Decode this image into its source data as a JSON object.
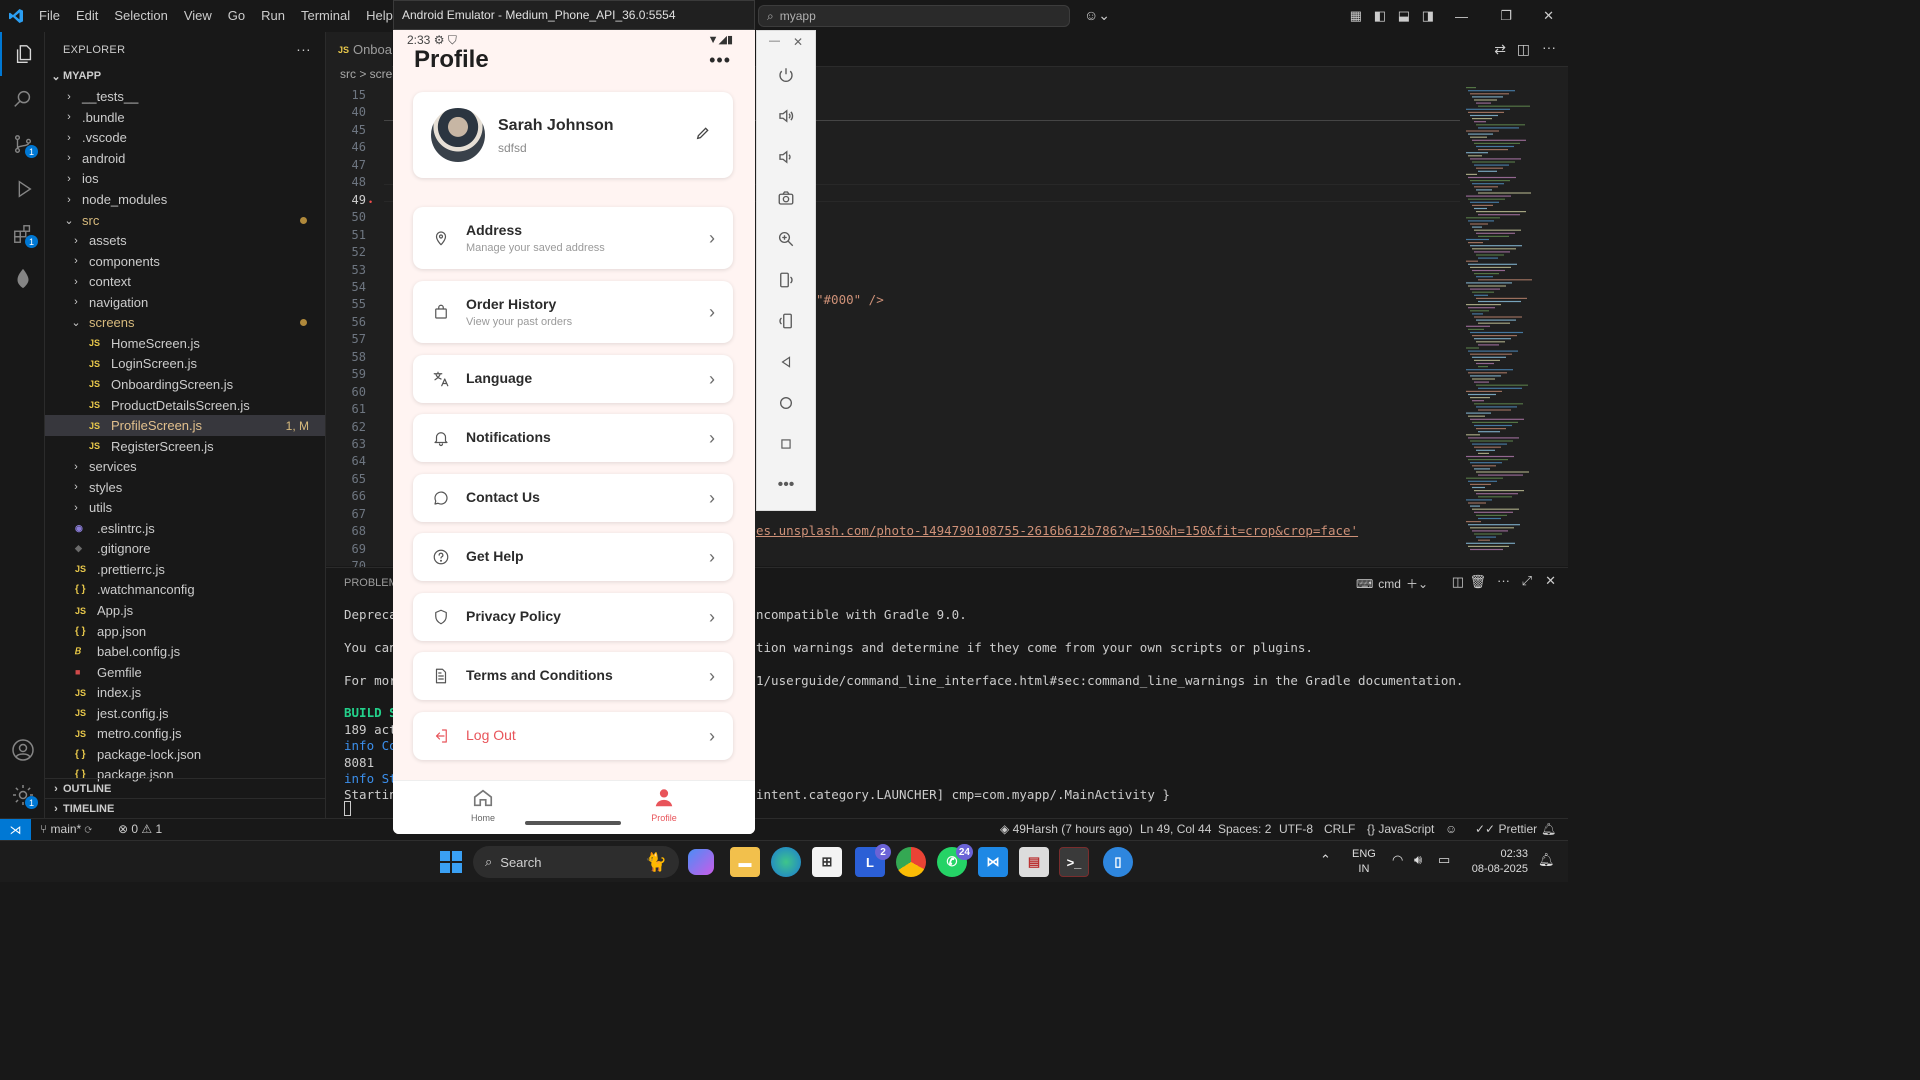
{
  "titlebar": {
    "menu": [
      "File",
      "Edit",
      "Selection",
      "View",
      "Go",
      "Run",
      "Terminal",
      "Help"
    ],
    "search": "myapp"
  },
  "explorer": {
    "title": "EXPLORER",
    "root": "MYAPP",
    "items": [
      {
        "label": "__tests__",
        "kind": "folder",
        "indent": 1
      },
      {
        "label": ".bundle",
        "kind": "folder",
        "indent": 1
      },
      {
        "label": ".vscode",
        "kind": "folder",
        "indent": 1
      },
      {
        "label": "android",
        "kind": "folder",
        "indent": 1
      },
      {
        "label": "ios",
        "kind": "folder",
        "indent": 1
      },
      {
        "label": "node_modules",
        "kind": "folder",
        "indent": 1
      },
      {
        "label": "src",
        "kind": "folder-open",
        "indent": 1
      },
      {
        "label": "assets",
        "kind": "folder",
        "indent": 2
      },
      {
        "label": "components",
        "kind": "folder",
        "indent": 2
      },
      {
        "label": "context",
        "kind": "folder",
        "indent": 2
      },
      {
        "label": "navigation",
        "kind": "folder",
        "indent": 2
      },
      {
        "label": "screens",
        "kind": "folder-open",
        "indent": 2
      },
      {
        "label": "HomeScreen.js",
        "kind": "js",
        "indent": 3
      },
      {
        "label": "LoginScreen.js",
        "kind": "js",
        "indent": 3
      },
      {
        "label": "OnboardingScreen.js",
        "kind": "js",
        "indent": 3
      },
      {
        "label": "ProductDetailsScreen.js",
        "kind": "js",
        "indent": 3
      },
      {
        "label": "ProfileScreen.js",
        "kind": "js",
        "indent": 3
      },
      {
        "label": "RegisterScreen.js",
        "kind": "js",
        "indent": 3
      },
      {
        "label": "services",
        "kind": "folder",
        "indent": 2
      },
      {
        "label": "styles",
        "kind": "folder",
        "indent": 2
      },
      {
        "label": "utils",
        "kind": "folder",
        "indent": 2
      },
      {
        "label": ".eslintrc.js",
        "kind": "eslint",
        "indent": 1
      },
      {
        "label": ".gitignore",
        "kind": "git",
        "indent": 1
      },
      {
        "label": ".prettierrc.js",
        "kind": "js",
        "indent": 1
      },
      {
        "label": ".watchmanconfig",
        "kind": "json",
        "indent": 1
      },
      {
        "label": "App.js",
        "kind": "js",
        "indent": 1
      },
      {
        "label": "app.json",
        "kind": "json",
        "indent": 1
      },
      {
        "label": "babel.config.js",
        "kind": "babel",
        "indent": 1
      },
      {
        "label": "Gemfile",
        "kind": "gem",
        "indent": 1
      },
      {
        "label": "index.js",
        "kind": "js",
        "indent": 1
      },
      {
        "label": "jest.config.js",
        "kind": "js",
        "indent": 1
      },
      {
        "label": "metro.config.js",
        "kind": "js",
        "indent": 1
      },
      {
        "label": "package-lock.json",
        "kind": "json",
        "indent": 1
      },
      {
        "label": "package.json",
        "kind": "json",
        "indent": 1
      }
    ],
    "selected_status": "1, M",
    "outline": "OUTLINE",
    "timeline": "TIMELINE"
  },
  "editor": {
    "tab": "Onboa",
    "breadcrumb": "src > scre",
    "line_numbers": [
      "15",
      "40",
      "45",
      "46",
      "47",
      "48",
      "49",
      "50",
      "51",
      "52",
      "53",
      "54",
      "55",
      "56",
      "57",
      "58",
      "59",
      "60",
      "61",
      "62",
      "63",
      "64",
      "65",
      "66",
      "67",
      "68",
      "69",
      "70"
    ],
    "code_line_55": "\"#000\" />",
    "code_line_68": "es.unsplash.com/photo-1494790108755-2616b612b786?w=150&h=150&fit=crop&crop=face'"
  },
  "panel": {
    "tab": "PROBLEMS",
    "shell": "cmd",
    "lines": [
      {
        "left": "Depreca",
        "right": "ncompatible with Gradle 9.0."
      },
      {
        "left": "You can",
        "right": "tion warnings and determine if they come from your own scripts or plugins."
      },
      {
        "left": "For mor",
        "right": "1/userguide/command_line_interface.html#sec:command_line_warnings in the Gradle documentation."
      },
      {
        "left": "BUILD S",
        "right": ""
      },
      {
        "left": "189 act",
        "right": ""
      },
      {
        "left": "info Co",
        "right": ""
      },
      {
        "left": "8081",
        "right": ""
      },
      {
        "left": "info St",
        "right": ""
      },
      {
        "left": "Startin",
        "right": "intent.category.LAUNCHER] cmp=com.myapp/.MainActivity }"
      }
    ]
  },
  "statusbar": {
    "branch": "main*",
    "problems": "⊗ 0 ⚠ 1",
    "blame": "49Harsh (7 hours ago)",
    "position": "Ln 49, Col 44",
    "spaces": "Spaces: 2",
    "encoding": "UTF-8",
    "eol": "CRLF",
    "language": "JavaScript",
    "prettier": "Prettier"
  },
  "emulator": {
    "title": "Android Emulator - Medium_Phone_API_36.0:5554",
    "time": "2:33",
    "screen_title": "Profile",
    "user": {
      "name": "Sarah Johnson",
      "subtitle": "sdfsd"
    },
    "menu": [
      {
        "label": "Address",
        "sub": "Manage your saved address",
        "icon": "map-pin-icon"
      },
      {
        "label": "Order History",
        "sub": "View your past orders",
        "icon": "shopping-bag-icon"
      },
      {
        "label": "Language",
        "sub": "",
        "icon": "translate-icon"
      },
      {
        "label": "Notifications",
        "sub": "",
        "icon": "bell-icon"
      },
      {
        "label": "Contact Us",
        "sub": "",
        "icon": "chat-icon"
      },
      {
        "label": "Get Help",
        "sub": "",
        "icon": "help-circle-icon"
      },
      {
        "label": "Privacy Policy",
        "sub": "",
        "icon": "shield-icon"
      },
      {
        "label": "Terms and Conditions",
        "sub": "",
        "icon": "document-icon"
      },
      {
        "label": "Log Out",
        "sub": "",
        "icon": "logout-icon"
      }
    ],
    "nav": {
      "home": "Home",
      "profile": "Profile"
    },
    "accent": "#e8545a"
  },
  "taskbar": {
    "search": "Search",
    "badges": {
      "l": "2",
      "whatsapp": "24"
    },
    "lang": "ENG",
    "region": "IN",
    "time": "02:33",
    "date": "08-08-2025"
  }
}
